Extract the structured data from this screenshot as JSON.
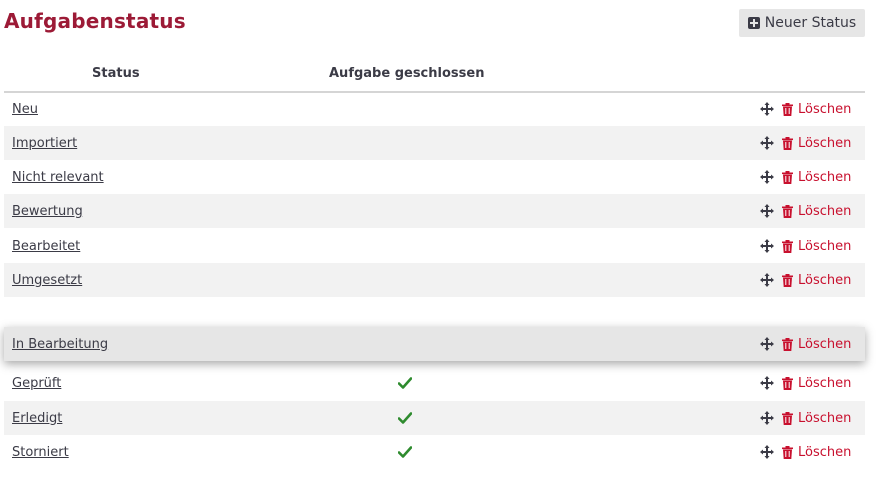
{
  "page": {
    "title": "Aufgabenstatus",
    "new_button_label": "Neuer Status"
  },
  "table": {
    "headers": {
      "status": "Status",
      "closed": "Aufgabe geschlossen"
    },
    "delete_label": "Löschen",
    "rows": [
      {
        "name": "Neu",
        "closed": false
      },
      {
        "name": "Importiert",
        "closed": false
      },
      {
        "name": "Nicht relevant",
        "closed": false
      },
      {
        "name": "Bewertung",
        "closed": false
      },
      {
        "name": "Bearbeitet",
        "closed": false
      },
      {
        "name": "Umgesetzt",
        "closed": false
      },
      {
        "name": "In Bearbeitung",
        "closed": false,
        "dragging": true
      },
      {
        "name": "Geprüft",
        "closed": true
      },
      {
        "name": "Erledigt",
        "closed": true
      },
      {
        "name": "Storniert",
        "closed": true
      }
    ]
  },
  "colors": {
    "title": "#9c1a36",
    "delete": "#c8102e",
    "check": "#2e8b2e",
    "row_alt": "#f2f2f2"
  }
}
